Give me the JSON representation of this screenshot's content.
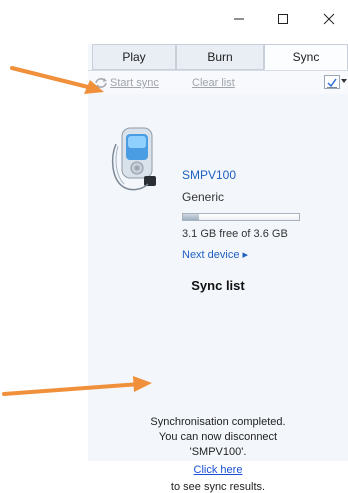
{
  "window_controls": {
    "minimize": "minimize-icon",
    "maximize": "maximize-icon",
    "close": "close-icon"
  },
  "tabs": [
    {
      "label": "Play"
    },
    {
      "label": "Burn"
    },
    {
      "label": "Sync",
      "active": true
    }
  ],
  "toolbar": {
    "start_sync": "Start sync",
    "clear_list": "Clear list"
  },
  "device": {
    "name": "SMPV100",
    "type": "Generic",
    "capacity_used_fraction": 0.14,
    "free_text": "3.1 GB free of 3.6 GB",
    "next_device": "Next device ▸"
  },
  "sync_list": {
    "title": "Sync list"
  },
  "status": {
    "line1": "Synchronisation completed.",
    "line2": "You can now disconnect",
    "line3": "'SMPV100'.",
    "link": "Click here",
    "line4": "to see sync results."
  },
  "colors": {
    "accent_link": "#1a4fd6",
    "device_link": "#1f5fbf",
    "arrow": "#f0903a"
  }
}
